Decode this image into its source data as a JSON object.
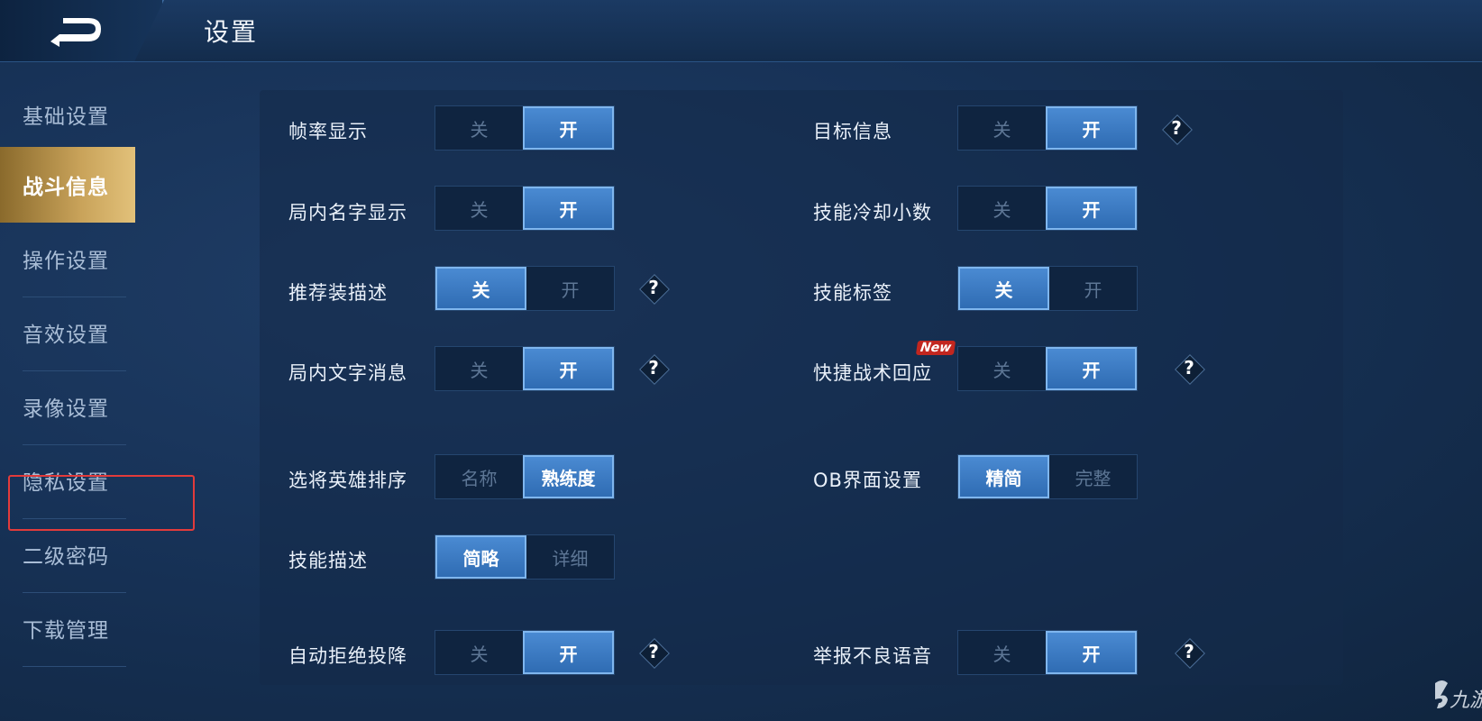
{
  "header": {
    "title": "设置",
    "back_icon": "back-arrow-icon"
  },
  "sidebar": {
    "items": [
      {
        "label": "基础设置"
      },
      {
        "label": "战斗信息",
        "active": true
      },
      {
        "label": "操作设置"
      },
      {
        "label": "音效设置"
      },
      {
        "label": "录像设置"
      },
      {
        "label": "隐私设置",
        "highlighted": true
      },
      {
        "label": "二级密码"
      },
      {
        "label": "下载管理"
      }
    ]
  },
  "settings": {
    "fps": {
      "label": "帧率显示",
      "off": "关",
      "on": "开",
      "selected": "开"
    },
    "target_info": {
      "label": "目标信息",
      "off": "关",
      "on": "开",
      "selected": "开"
    },
    "name_display": {
      "label": "局内名字显示",
      "off": "关",
      "on": "开",
      "selected": "开"
    },
    "cooldown_decimal": {
      "label": "技能冷却小数",
      "off": "关",
      "on": "开",
      "selected": "开"
    },
    "recommend_desc": {
      "label": "推荐装描述",
      "off": "关",
      "on": "开",
      "selected": "关"
    },
    "skill_tag": {
      "label": "技能标签",
      "off": "关",
      "on": "开",
      "selected": "关"
    },
    "text_message": {
      "label": "局内文字消息",
      "off": "关",
      "on": "开",
      "selected": "开"
    },
    "quick_tactics": {
      "label": "快捷战术回应",
      "badge": "New",
      "off": "关",
      "on": "开",
      "selected": "开"
    },
    "hero_sort": {
      "label": "选将英雄排序",
      "a": "名称",
      "b": "熟练度",
      "selected": "熟练度"
    },
    "ob_interface": {
      "label": "OB界面设置",
      "a": "精简",
      "b": "完整",
      "selected": "精简"
    },
    "skill_desc": {
      "label": "技能描述",
      "a": "简略",
      "b": "详细",
      "selected": "简略"
    },
    "auto_refuse": {
      "label": "自动拒绝投降",
      "off": "关",
      "on": "开",
      "selected": "开"
    },
    "report_voice": {
      "label": "举报不良语音",
      "off": "关",
      "on": "开",
      "selected": "开"
    }
  },
  "help_symbol": "?",
  "colors": {
    "active_tab": "#c9a35a",
    "toggle_on": "#2f6cb3",
    "highlight_box": "#e23b3b"
  },
  "watermark": {
    "text": "九游",
    "icon": "jiuyou-logo-icon"
  }
}
